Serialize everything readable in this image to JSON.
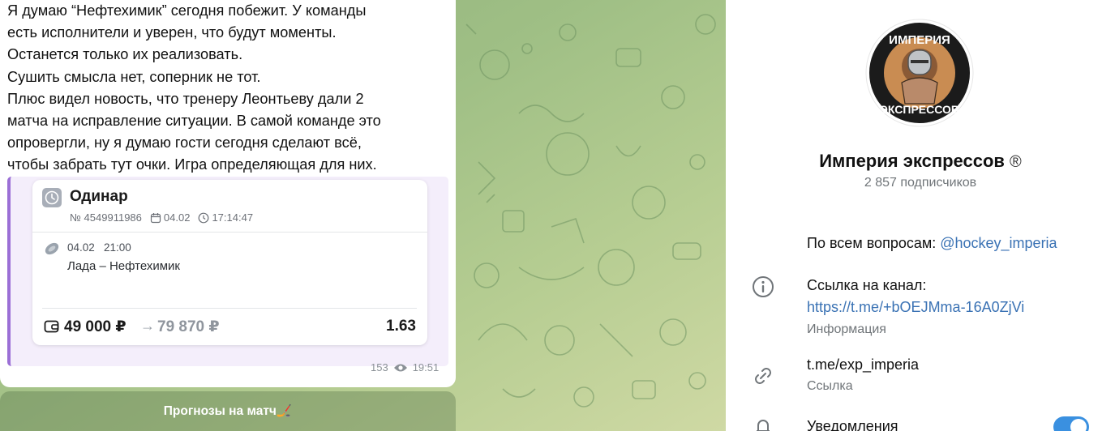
{
  "chat": {
    "message_lines": [
      "Я думаю “Нефтехимик” сегодня побежит. У команды",
      "есть исполнители и уверен, что будут моменты.",
      "Останется только их реализовать.",
      "Сушить смысла нет, соперник не тот.",
      "Плюс видел новость, что тренеру Леонтьеву дали 2",
      "матча на исправление ситуации. В самой команде это",
      "опровергли, ну я думаю гости сегодня сделают всё,",
      "чтобы забрать тут очки. Игра определяющая для них."
    ],
    "bet_card": {
      "type": "Одинар",
      "number": "№ 4549911986",
      "date": "04.02",
      "time": "17:14:47",
      "event_datetime": "04.02   21:00",
      "match": "Лада – Нефтехимик",
      "stake": "49 000 ₽",
      "arrow": "→",
      "payout": "79 870 ₽",
      "odds": "1.63"
    },
    "views": "153",
    "post_time": "19:51",
    "comments_button": "Прогнозы на матч🏒"
  },
  "panel": {
    "avatar_text_top": "ИМПЕРИЯ",
    "avatar_text_bottom": "ЭКСПРЕССОВ",
    "channel_name": "Империя экспрессов",
    "registered_mark": "®",
    "subscribers": "2 857 подписчиков",
    "questions_label": "По всем вопросам: ",
    "questions_link": "@hockey_imperia",
    "channel_link_label": "Ссылка на канал:",
    "channel_link": "https://t.me/+bOEJMma-16A0ZjVi",
    "info_label": "Информация",
    "short_link": "t.me/exp_imperia",
    "short_link_label": "Ссылка",
    "notifications_label": "Уведомления",
    "notifications_on": true
  },
  "colors": {
    "accent": "#3a72b4",
    "card_border": "#9b6fd6",
    "toggle": "#3a90e0"
  }
}
